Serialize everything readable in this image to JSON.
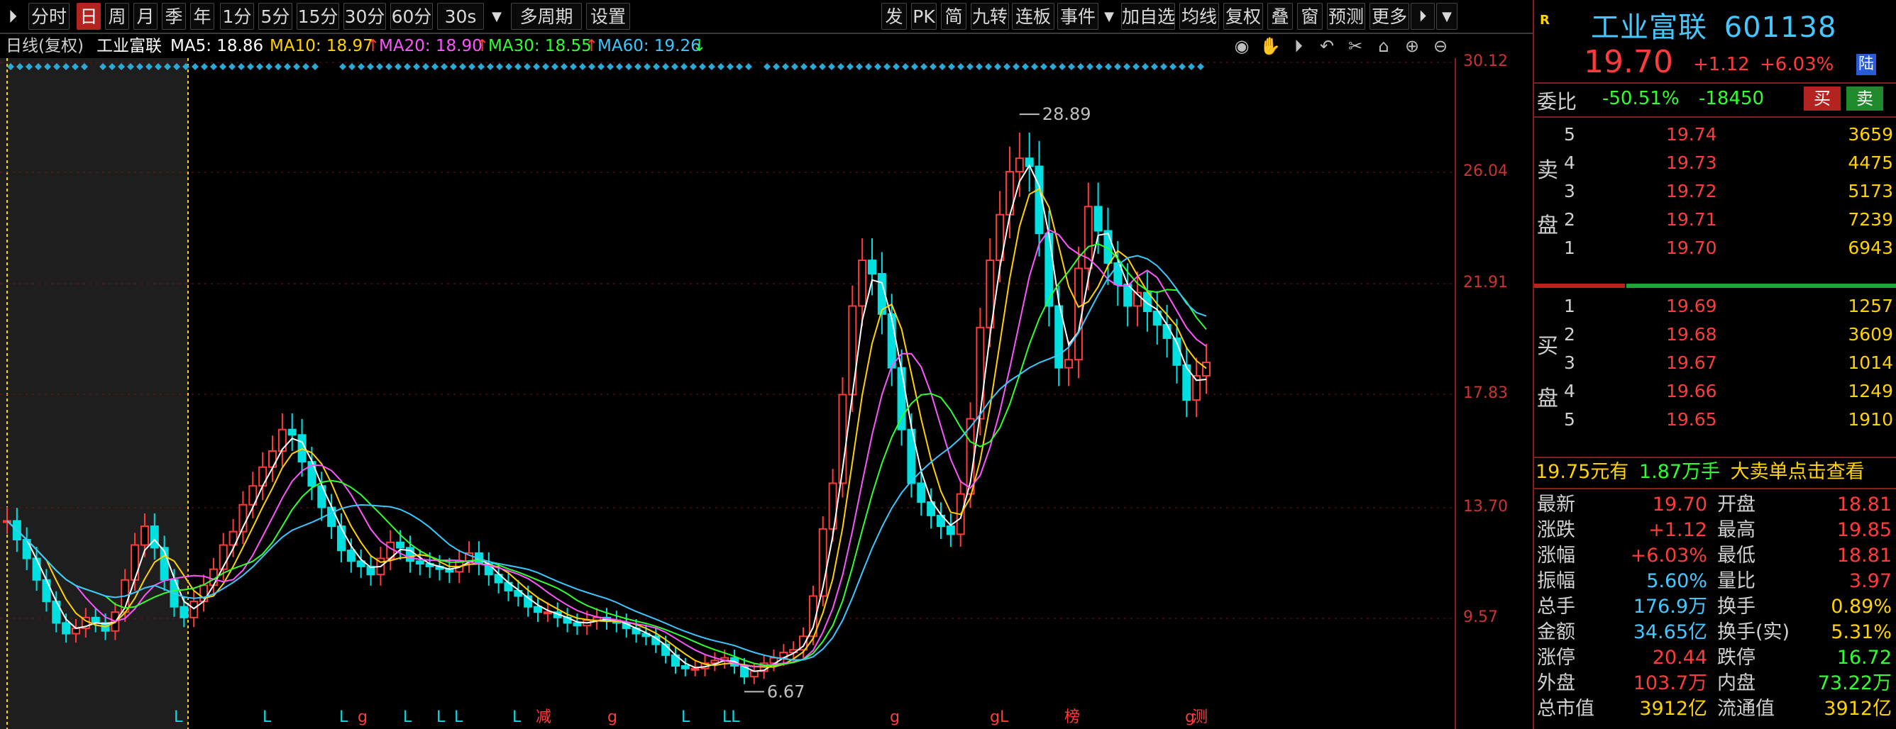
{
  "toolbar": {
    "left": [
      {
        "id": "fenshi",
        "label": "分时"
      },
      {
        "id": "ri",
        "label": "日",
        "active": true
      },
      {
        "id": "zhou",
        "label": "周"
      },
      {
        "id": "yue",
        "label": "月"
      },
      {
        "id": "ji",
        "label": "季"
      },
      {
        "id": "nian",
        "label": "年"
      },
      {
        "id": "1fen",
        "label": "1分"
      },
      {
        "id": "5fen",
        "label": "5分"
      },
      {
        "id": "15fen",
        "label": "15分"
      },
      {
        "id": "30fen",
        "label": "30分"
      },
      {
        "id": "60fen",
        "label": "60分"
      },
      {
        "id": "30s",
        "label": "30s"
      },
      {
        "id": "duozhouqi",
        "label": "多周期"
      },
      {
        "id": "shezhi",
        "label": "设置"
      }
    ],
    "right": [
      {
        "id": "fa",
        "label": "发"
      },
      {
        "id": "pk",
        "label": "PK"
      },
      {
        "id": "jian",
        "label": "简"
      },
      {
        "id": "jiuzhuan",
        "label": "九转"
      },
      {
        "id": "lianban",
        "label": "连板"
      },
      {
        "id": "shijian",
        "label": "事件"
      },
      {
        "id": "jiazixuan",
        "label": "加自选"
      },
      {
        "id": "junxian",
        "label": "均线"
      },
      {
        "id": "fuquan",
        "label": "复权"
      },
      {
        "id": "die",
        "label": "叠"
      },
      {
        "id": "chuang",
        "label": "窗"
      },
      {
        "id": "yuce",
        "label": "预测"
      },
      {
        "id": "gengduo",
        "label": "更多"
      }
    ]
  },
  "infoline": {
    "period": "日线(复权)",
    "stock": "工业富联",
    "ma5": "MA5: 18.86",
    "ma10": "MA10: 18.97",
    "ma20": "MA20: 18.90",
    "ma30": "MA30: 18.55",
    "ma60": "MA60: 19.26",
    "arrow_up": "↑",
    "arrow_down": "↓"
  },
  "colors": {
    "up": "#ff3b3b",
    "down": "#00e0e0",
    "ma5": "#ffffff",
    "ma10": "#ffd200",
    "ma20": "#ff55ff",
    "ma30": "#30ff30",
    "ma60": "#3cc8ff",
    "grid": "#7a1010"
  },
  "chart_data": {
    "type": "line",
    "title": "工业富联",
    "y_ticks": [
      "30.12",
      "26.04",
      "21.91",
      "17.83",
      "13.70",
      "9.57"
    ],
    "ylim": [
      7.0,
      30.5
    ],
    "annotations": [
      {
        "text": "28.89",
        "label": "high"
      },
      {
        "text": "6.67",
        "label": "low"
      }
    ],
    "bottom_markers": [
      {
        "text": "L",
        "color": "#00e0e0"
      },
      {
        "text": "L",
        "color": "#00e0e0"
      },
      {
        "text": "L",
        "color": "#00e0e0"
      },
      {
        "text": "g",
        "color": "#ff3b3b"
      },
      {
        "text": "L",
        "color": "#00e0e0"
      },
      {
        "text": "L",
        "color": "#00e0e0"
      },
      {
        "text": "L",
        "color": "#00e0e0"
      },
      {
        "text": "L",
        "color": "#00e0e0"
      },
      {
        "text": "减",
        "color": "#ff3b3b"
      },
      {
        "text": "g",
        "color": "#ff3b3b"
      },
      {
        "text": "L",
        "color": "#00e0e0"
      },
      {
        "text": "LL",
        "color": "#00e0e0"
      },
      {
        "text": "g",
        "color": "#ff3b3b"
      },
      {
        "text": "gL",
        "color": "#ff3b3b"
      },
      {
        "text": "榜",
        "color": "#ff3b3b"
      },
      {
        "text": "g",
        "color": "#ff3b3b"
      },
      {
        "text": "测",
        "color": "#ff3b3b"
      }
    ],
    "close_series": [
      13.8,
      13.1,
      12.4,
      11.6,
      10.8,
      10.0,
      9.6,
      9.8,
      10.2,
      10.0,
      9.7,
      10.4,
      11.6,
      12.9,
      13.6,
      12.8,
      11.6,
      10.6,
      10.2,
      10.8,
      11.4,
      12.0,
      12.9,
      13.4,
      14.4,
      15.1,
      15.8,
      16.4,
      17.2,
      17.0,
      16.0,
      15.1,
      14.3,
      13.6,
      12.7,
      12.3,
      12.1,
      11.8,
      12.4,
      13.0,
      12.8,
      12.3,
      12.2,
      12.1,
      12.0,
      11.9,
      12.3,
      12.6,
      12.2,
      11.8,
      11.5,
      11.2,
      11.0,
      10.6,
      10.4,
      10.4,
      10.2,
      10.0,
      9.9,
      10.1,
      10.2,
      10.1,
      10.0,
      9.8,
      9.6,
      9.5,
      9.2,
      8.8,
      8.4,
      8.3,
      8.3,
      8.5,
      8.6,
      8.7,
      8.4,
      8.0,
      8.2,
      8.5,
      8.7,
      8.9,
      9.0,
      9.5,
      11.0,
      13.5,
      15.2,
      18.5,
      21.8,
      23.5,
      23.0,
      21.5,
      19.5,
      17.2,
      15.2,
      14.5,
      14.0,
      13.6,
      13.3,
      14.8,
      17.6,
      21.0,
      23.5,
      25.2,
      26.8,
      27.3,
      27.0,
      24.5,
      21.8,
      19.5,
      19.8,
      23.2,
      25.5,
      24.6,
      23.4,
      22.6,
      21.8,
      22.3,
      21.6,
      21.1,
      20.6,
      19.6,
      18.3,
      19.2,
      19.7
    ],
    "ma_series_label": "MA60"
  },
  "panel": {
    "r_mark": "R",
    "name": "工业富联",
    "code": "601138",
    "price": "19.70",
    "change": "+1.12",
    "change_pct": "+6.03%",
    "lu": "陆",
    "weibi_label": "委比",
    "weibi_pct": "-50.51%",
    "weibi_val": "-18450",
    "buy_btn": "买",
    "sell_btn": "卖",
    "sell_side_label": [
      "卖",
      "盘"
    ],
    "buy_side_label": [
      "买",
      "盘"
    ],
    "asks": [
      {
        "lvl": "5",
        "price": "19.74",
        "vol": "3659"
      },
      {
        "lvl": "4",
        "price": "19.73",
        "vol": "4475"
      },
      {
        "lvl": "3",
        "price": "19.72",
        "vol": "5173"
      },
      {
        "lvl": "2",
        "price": "19.71",
        "vol": "7239"
      },
      {
        "lvl": "1",
        "price": "19.70",
        "vol": "6943"
      }
    ],
    "bids": [
      {
        "lvl": "1",
        "price": "19.69",
        "vol": "1257"
      },
      {
        "lvl": "2",
        "price": "19.68",
        "vol": "3609"
      },
      {
        "lvl": "3",
        "price": "19.67",
        "vol": "1014"
      },
      {
        "lvl": "4",
        "price": "19.66",
        "vol": "1249"
      },
      {
        "lvl": "5",
        "price": "19.65",
        "vol": "1910"
      }
    ],
    "big_order": {
      "price": "19.75元有",
      "vol": "1.87万手",
      "text": "大卖单点击查看"
    },
    "stats": [
      {
        "l1": "最新",
        "v1": "19.70",
        "c1": "#ff3b3b",
        "l2": "开盘",
        "v2": "18.81",
        "c2": "#ff3b3b"
      },
      {
        "l1": "涨跌",
        "v1": "+1.12",
        "c1": "#ff3b3b",
        "l2": "最高",
        "v2": "19.85",
        "c2": "#ff3b3b"
      },
      {
        "l1": "涨幅",
        "v1": "+6.03%",
        "c1": "#ff3b3b",
        "l2": "最低",
        "v2": "18.81",
        "c2": "#ff3b3b"
      },
      {
        "l1": "振幅",
        "v1": "5.60%",
        "c1": "#44c8ff",
        "l2": "量比",
        "v2": "3.97",
        "c2": "#ff3b3b"
      },
      {
        "l1": "总手",
        "v1": "176.9万",
        "c1": "#44c8ff",
        "l2": "换手",
        "v2": "0.89%",
        "c2": "#ffd200"
      },
      {
        "l1": "金额",
        "v1": "34.65亿",
        "c1": "#44c8ff",
        "l2": "换手(实)",
        "v2": "5.31%",
        "c2": "#ffd200"
      },
      {
        "l1": "涨停",
        "v1": "20.44",
        "c1": "#ff3b3b",
        "l2": "跌停",
        "v2": "16.72",
        "c2": "#30ff30"
      },
      {
        "l1": "外盘",
        "v1": "103.7万",
        "c1": "#ff3b3b",
        "l2": "内盘",
        "v2": "73.22万",
        "c2": "#30ff30"
      },
      {
        "l1": "总市值",
        "v1": "3912亿",
        "c1": "#ffd200",
        "l2": "流通值",
        "v2": "3912亿",
        "c2": "#ffd200"
      }
    ]
  }
}
